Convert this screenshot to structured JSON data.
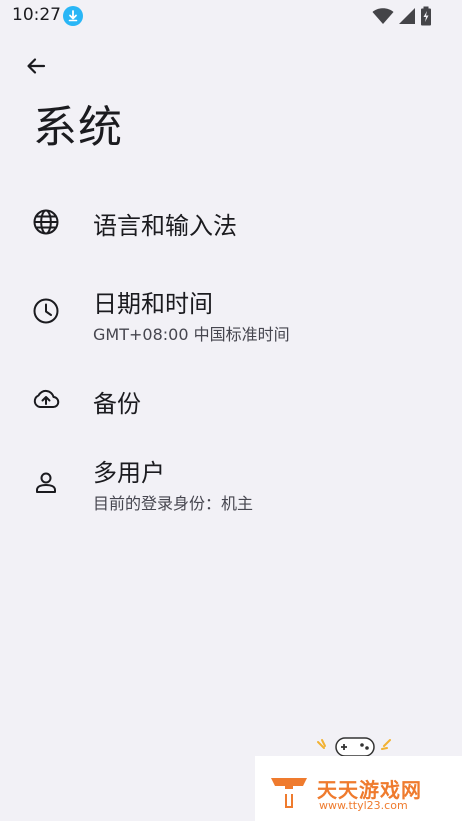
{
  "status_bar": {
    "time": "10:27",
    "download_icon": "download-icon",
    "wifi_icon": "wifi-icon",
    "signal_icon": "signal-icon",
    "battery_icon": "battery-charging-icon"
  },
  "header": {
    "back_icon": "arrow-back-icon",
    "title": "系统"
  },
  "settings": {
    "items": [
      {
        "icon": "globe-icon",
        "title": "语言和输入法",
        "subtitle": ""
      },
      {
        "icon": "clock-icon",
        "title": "日期和时间",
        "subtitle": "GMT+08:00 中国标准时间"
      },
      {
        "icon": "cloud-upload-icon",
        "title": "备份",
        "subtitle": ""
      },
      {
        "icon": "person-icon",
        "title": "多用户",
        "subtitle": "目前的登录身份：机主"
      }
    ]
  },
  "watermark": {
    "name": "天天游戏网",
    "url": "www.ttyl23.com"
  },
  "colors": {
    "background": "#f2f1f6",
    "text_primary": "#1b1b1f",
    "text_secondary": "#46464f",
    "download_badge": "#29b6f6",
    "watermark_accent": "#ef7b2e"
  }
}
